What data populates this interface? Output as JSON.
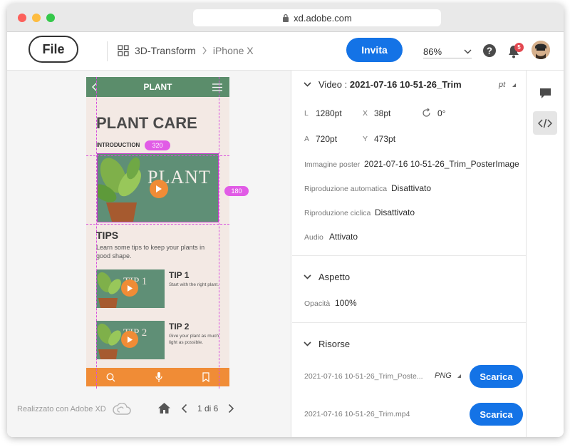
{
  "browser": {
    "url": "xd.adobe.com"
  },
  "header": {
    "file_label": "File",
    "breadcrumb": [
      "3D-Transform",
      "iPhone X"
    ],
    "invite_label": "Invita",
    "zoom": "86%",
    "notifications_count": "5"
  },
  "artboard": {
    "nav_title": "PLANT",
    "title": "PLANT CARE",
    "intro": "INTRODUCTION",
    "hero_text": "PLANT",
    "tips_title": "TIPS",
    "tips_desc": "Learn some tips to keep your plants in good shape.",
    "tips": [
      {
        "title": "TIP 1",
        "desc": "Start with the right plant.",
        "img_text": "TIP 1"
      },
      {
        "title": "TIP 2",
        "desc": "Give your plant as much light as possible.",
        "img_text": "TIP 2"
      }
    ],
    "width_badge": "320",
    "height_badge": "180"
  },
  "canvas_footer": {
    "made_with": "Realizzato con Adobe XD",
    "page_indicator": "1 di 6"
  },
  "inspect": {
    "video": {
      "heading": "Video : ",
      "name": "2021-07-16 10-51-26_Trim",
      "unit": "pt",
      "L_label": "L",
      "L": "1280pt",
      "X_label": "X",
      "X": "38pt",
      "rot": "0°",
      "A_label": "A",
      "A": "720pt",
      "Y_label": "Y",
      "Y": "473pt",
      "poster_label": "Immagine poster",
      "poster": "2021-07-16 10-51-26_Trim_PosterImage",
      "autoplay_label": "Riproduzione automatica",
      "autoplay": "Disattivato",
      "loop_label": "Riproduzione ciclica",
      "loop": "Disattivato",
      "audio_label": "Audio",
      "audio": "Attivato"
    },
    "appearance": {
      "heading": "Aspetto",
      "opacity_label": "Opacità",
      "opacity": "100%"
    },
    "assets": {
      "heading": "Risorse",
      "items": [
        {
          "name": "2021-07-16 10-51-26_Trim_Poste...",
          "format": "PNG",
          "button": "Scarica"
        },
        {
          "name": "2021-07-16 10-51-26_Trim.mp4",
          "format": "",
          "button": "Scarica"
        }
      ]
    }
  },
  "colors": {
    "accent": "#1473e6",
    "plant_green": "#5b8d6b",
    "orange": "#f08c36",
    "guide": "#d84ede"
  }
}
